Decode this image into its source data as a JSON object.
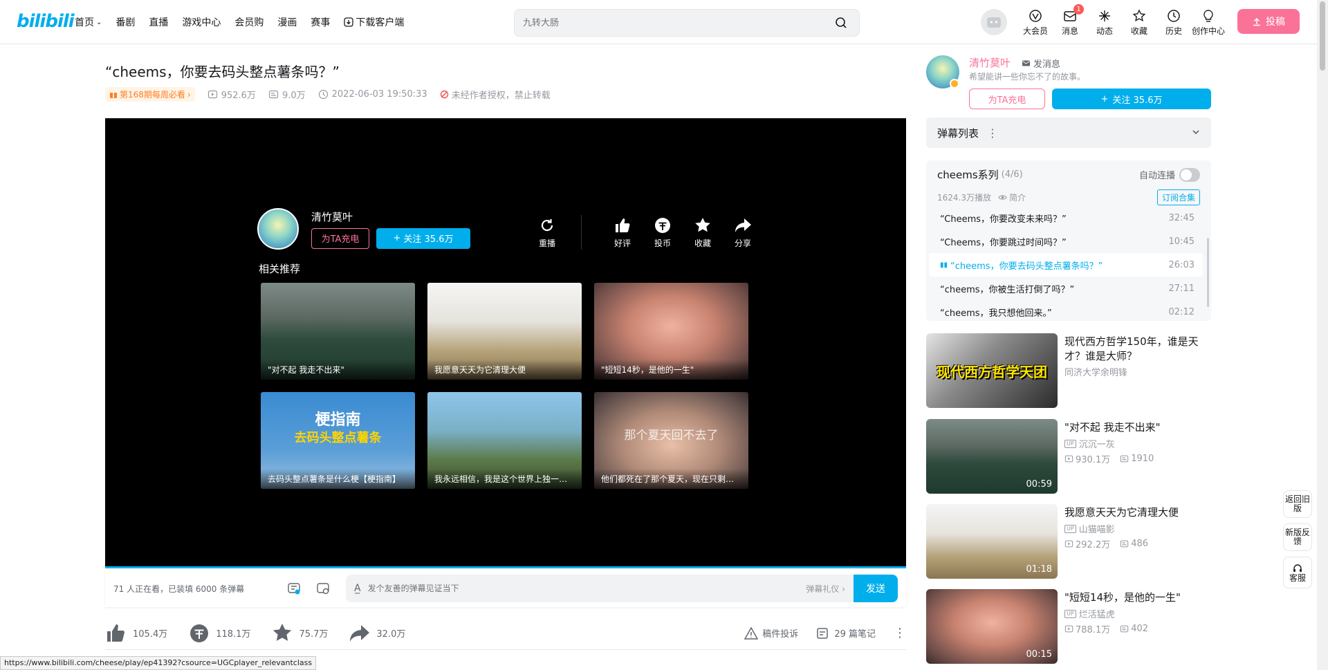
{
  "header": {
    "logo": "bilibili",
    "nav": [
      "首页",
      "番剧",
      "直播",
      "游戏中心",
      "会员购",
      "漫画",
      "赛事",
      "下载客户端"
    ],
    "search_placeholder": "九转大肠",
    "right_items": [
      {
        "label": "大会员",
        "icon": "vip-icon"
      },
      {
        "label": "消息",
        "icon": "mail-icon",
        "badge": "1"
      },
      {
        "label": "动态",
        "icon": "dynamic-icon"
      },
      {
        "label": "收藏",
        "icon": "star-icon"
      },
      {
        "label": "历史",
        "icon": "clock-icon"
      },
      {
        "label": "创作中心",
        "icon": "bulb-icon"
      }
    ],
    "upload": "投稿"
  },
  "video": {
    "title": "“cheems，你要去码头整点薯条吗？”",
    "weekly_badge": "第168期每周必看",
    "views": "952.6万",
    "danmaku": "9.0万",
    "date": "2022-06-03 19:50:33",
    "no_repost": "未经作者授权，禁止转载"
  },
  "endscreen": {
    "up_name": "清竹莫叶",
    "charge": "为TA充电",
    "follow": "关注 35.6万",
    "actions": [
      "重播",
      "好评",
      "投币",
      "收藏",
      "分享"
    ],
    "rec_title": "相关推荐",
    "recs": [
      {
        "caption": "\"对不起 我走不出来\""
      },
      {
        "caption": "我愿意天天为它清理大便"
      },
      {
        "caption": "\"短短14秒，是他的一生\""
      },
      {
        "caption": "去码头整点薯条是什么梗【梗指南】",
        "overlay_top": "梗指南",
        "overlay_sub": "去码头整点薯条"
      },
      {
        "caption": "我永远相信，我是这个世界上独一无二的"
      },
      {
        "caption": "他们都死在了那个夏天，现在只剩我了",
        "overlay_top": "那个夏天回不去了"
      }
    ]
  },
  "danmaku_bar": {
    "info": "71 人正在看，已装填 6000 条弹幕",
    "placeholder": "发个友善的弹幕见证当下",
    "etiquette": "弹幕礼仪",
    "send": "发送"
  },
  "toolbar": {
    "like": "105.4万",
    "coin": "118.1万",
    "fav": "75.7万",
    "share": "32.0万",
    "report": "稿件投诉",
    "notes": "29 篇笔记"
  },
  "status_url": "https://www.bilibili.com/cheese/play/ep41392?csource=UGCplayer_relevantclass",
  "up": {
    "name": "清竹莫叶",
    "message": "发消息",
    "desc": "希望能讲一些你忘不了的故事。",
    "charge": "为TA充电",
    "follow": "关注 35.6万"
  },
  "danmaku_list": {
    "title": "弹幕列表"
  },
  "series": {
    "title": "cheems系列",
    "count": "(4/6)",
    "auto_next": "自动连播",
    "plays": "1624.3万播放",
    "intro": "简介",
    "subscribe": "订阅合集",
    "episodes": [
      {
        "title": "“Cheems，你要改变未来吗？”",
        "dur": "32:45"
      },
      {
        "title": "“Cheems，你要跳过时间吗？”",
        "dur": "10:45"
      },
      {
        "title": "“cheems，你要去码头整点薯条吗？”",
        "dur": "26:03",
        "active": true
      },
      {
        "title": "“cheems，你被生活打倒了吗？”",
        "dur": "27:11"
      },
      {
        "title": "“cheems，我只想他回来。”",
        "dur": "02:12"
      }
    ]
  },
  "side_recs": [
    {
      "title": "现代西方哲学150年，谁是天才？谁是大师？",
      "up": "同济大学余明锋",
      "views": "",
      "comments": "",
      "dur": "",
      "overlay": "现代西方哲学天团"
    },
    {
      "title": "\"对不起 我走不出来\"",
      "up": "沉沉一灰",
      "views": "930.1万",
      "comments": "1910",
      "dur": "00:59"
    },
    {
      "title": "我愿意天天为它清理大便",
      "up": "山猫喵影",
      "views": "292.2万",
      "comments": "486",
      "dur": "01:18"
    },
    {
      "title": "\"短短14秒，是他的一生\"",
      "up": "烂活猛虎",
      "views": "788.1万",
      "comments": "402",
      "dur": "00:15"
    }
  ],
  "float": [
    "返回旧版",
    "新版反馈",
    "客服"
  ]
}
